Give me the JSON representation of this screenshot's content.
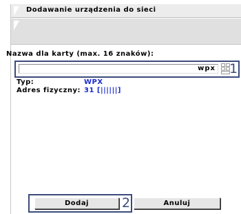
{
  "dialog": {
    "title": "Dodawanie urządzenia do sieci"
  },
  "form": {
    "name_label": "Nazwa dla karty (max. 16 znaków):",
    "name_value": "wpx",
    "type_label": "Typ:",
    "type_value": "WPX",
    "address_label": "Adres fizyczny:",
    "address_value": "31  [||||||]"
  },
  "buttons": {
    "add_label": "Dodaj",
    "cancel_label": "Anuluj"
  },
  "annotations": {
    "marker_1": "1",
    "marker_2": "2"
  },
  "icons": {
    "keyboard": "keyboard-icon"
  },
  "colors": {
    "value_blue": "#1a2bd0",
    "annotation": "#3a4a7a",
    "title_bg": "#ececec"
  }
}
